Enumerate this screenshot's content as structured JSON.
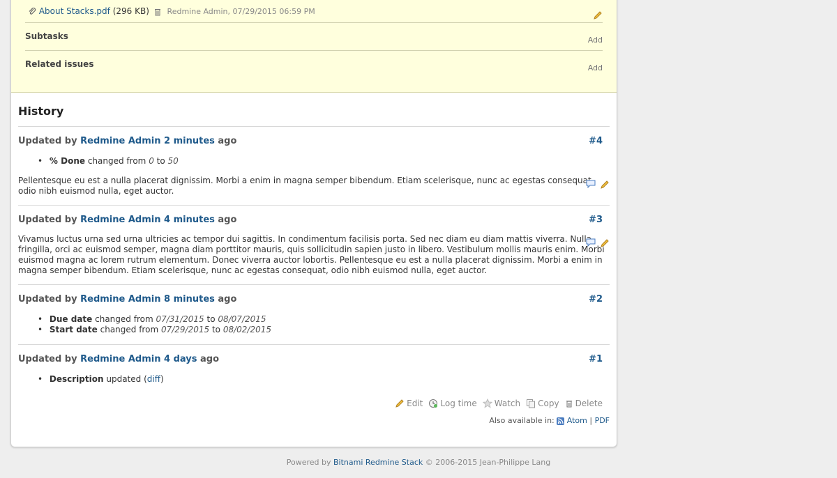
{
  "attachment": {
    "name": "About Stacks.pdf",
    "size": "(296 KB)",
    "meta": "Redmine Admin, 07/29/2015 06:59 PM"
  },
  "subtasks": {
    "title": "Subtasks",
    "add": "Add"
  },
  "related": {
    "title": "Related issues",
    "add": "Add"
  },
  "history": {
    "title": "History",
    "journals": [
      {
        "prefix": "Updated by",
        "user": "Redmine Admin",
        "time": "2 minutes",
        "suffix": "ago",
        "number": "#4",
        "details": [
          {
            "field": "% Done",
            "changed": "changed from",
            "from": "0",
            "to_word": "to",
            "to": "50"
          }
        ],
        "note": "Pellentesque eu est a nulla placerat dignissim. Morbi a enim in magna semper bibendum. Etiam scelerisque, nunc ac egestas consequat, odio nibh euismod nulla, eget auctor."
      },
      {
        "prefix": "Updated by",
        "user": "Redmine Admin",
        "time": "4 minutes",
        "suffix": "ago",
        "number": "#3",
        "note": "Vivamus luctus urna sed urna ultricies ac tempor dui sagittis. In condimentum facilisis porta. Sed nec diam eu diam mattis viverra. Nulla fringilla, orci ac euismod semper, magna diam porttitor mauris, quis sollicitudin sapien justo in libero. Vestibulum mollis mauris enim. Morbi euismod magna ac lorem rutrum elementum. Donec viverra auctor lobortis. Pellentesque eu est a nulla placerat dignissim. Morbi a enim in magna semper bibendum. Etiam scelerisque, nunc ac egestas consequat, odio nibh euismod nulla, eget auctor."
      },
      {
        "prefix": "Updated by",
        "user": "Redmine Admin",
        "time": "8 minutes",
        "suffix": "ago",
        "number": "#2",
        "details": [
          {
            "field": "Due date",
            "changed": "changed from",
            "from": "07/31/2015",
            "to_word": "to",
            "to": "08/07/2015"
          },
          {
            "field": "Start date",
            "changed": "changed from",
            "from": "07/29/2015",
            "to_word": "to",
            "to": "08/02/2015"
          }
        ]
      },
      {
        "prefix": "Updated by",
        "user": "Redmine Admin",
        "time": "4 days",
        "suffix": "ago",
        "number": "#1",
        "details": [
          {
            "field": "Description",
            "updated": "updated",
            "diff": "diff"
          }
        ]
      }
    ]
  },
  "actions": {
    "edit": "Edit",
    "log_time": "Log time",
    "watch": "Watch",
    "copy": "Copy",
    "delete": "Delete"
  },
  "also": {
    "label": "Also available in:",
    "atom": "Atom",
    "sep": "|",
    "pdf": "PDF"
  },
  "footer": {
    "powered": "Powered by",
    "product": "Bitnami Redmine Stack",
    "copyright": "© 2006-2015 Jean-Philippe Lang"
  },
  "colors": {
    "link": "#1f5a8b",
    "issue_bg": "#ffffdd",
    "page_bg": "#eeeeee"
  }
}
